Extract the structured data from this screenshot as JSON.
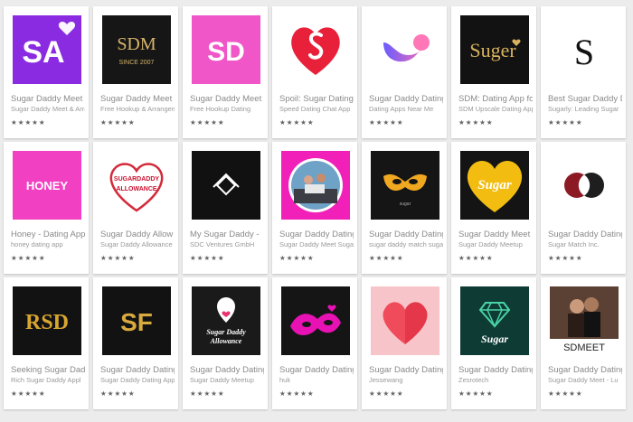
{
  "apps": [
    {
      "title": "Sugar Daddy Meet",
      "developer": "Sugar Daddy Meet & Arrangement",
      "stars": "★★★★★",
      "icon": {
        "name": "sa-logo-icon",
        "bg": "#8a2be2",
        "text": "SA"
      }
    },
    {
      "title": "Sugar Daddy Meet",
      "developer": "Free Hookup & Arrangement",
      "stars": "★★★★★",
      "icon": {
        "name": "sdm-logo-icon",
        "bg": "#161616",
        "text": "SDM",
        "sub": "SINCE 2007"
      }
    },
    {
      "title": "Sugar Daddy Meet",
      "developer": "Free Hookup Dating",
      "stars": "★★★★★",
      "icon": {
        "name": "sd-logo-icon",
        "bg": "#f056c8",
        "text": "SD"
      }
    },
    {
      "title": "Spoil: Sugar Dating",
      "developer": "Speed Dating Chat App",
      "stars": "★★★★★",
      "icon": {
        "name": "heart-s-icon",
        "bg": "#ffffff"
      }
    },
    {
      "title": "Sugar Daddy Dating",
      "developer": "Dating Apps Near Me",
      "stars": "★★★★★",
      "icon": {
        "name": "ribbon-heart-icon",
        "bg": "#ffffff"
      }
    },
    {
      "title": "SDM: Dating App for",
      "developer": "SDM Upscale Dating App",
      "stars": "★★★★★",
      "icon": {
        "name": "suger-logo-icon",
        "bg": "#121212",
        "text": "Suger"
      }
    },
    {
      "title": "Best Sugar Daddy D",
      "developer": "Sugarly: Leading Sugar",
      "stars": "★★★★★",
      "icon": {
        "name": "s-letter-icon",
        "bg": "#ffffff",
        "text": "S"
      }
    },
    {
      "title": "Honey - Dating App",
      "developer": "honey dating app",
      "stars": "★★★★★",
      "icon": {
        "name": "honey-logo-icon",
        "bg": "#f240c2",
        "text": "HONEY"
      }
    },
    {
      "title": "Sugar Daddy Allow",
      "developer": "Sugar Daddy Allowance",
      "stars": "★★★★★",
      "icon": {
        "name": "allowance-heart-icon",
        "bg": "#ffffff",
        "text": "SUGARDADDY",
        "sub": "ALLOWANCE"
      }
    },
    {
      "title": "My Sugar Daddy -",
      "developer": "SDC Ventures GmbH",
      "stars": "★★★★★",
      "icon": {
        "name": "diamond-outline-icon",
        "bg": "#111111"
      }
    },
    {
      "title": "Sugar Daddy Dating",
      "developer": "Sugar Daddy Meet Sugar",
      "stars": "★★★★★",
      "icon": {
        "name": "couple-photo-icon",
        "bg": "#f020b8"
      }
    },
    {
      "title": "Sugar Daddy Dating",
      "developer": "sugar daddy match sugar",
      "stars": "★★★★★",
      "icon": {
        "name": "mask-icon",
        "bg": "#151515",
        "sub": "sugar"
      }
    },
    {
      "title": "Sugar Daddy Meet",
      "developer": "Sugar Daddy Meetup",
      "stars": "★★★★★",
      "icon": {
        "name": "gold-heart-icon",
        "bg": "#141414",
        "text": "Sugar"
      }
    },
    {
      "title": "Sugar Daddy Dating",
      "developer": "Sugar Match Inc.",
      "stars": "★★★★★",
      "icon": {
        "name": "overlap-circles-icon",
        "bg": "#ffffff"
      }
    },
    {
      "title": "Seeking Sugar Dad",
      "developer": "Rich Sugar Daddy Appl",
      "stars": "★★★★★",
      "icon": {
        "name": "rsd-logo-icon",
        "bg": "#121212",
        "text": "RSD"
      }
    },
    {
      "title": "Sugar Daddy Dating",
      "developer": "Sugar Daddy Dating App",
      "stars": "★★★★★",
      "icon": {
        "name": "sf-logo-icon",
        "bg": "#121212",
        "text": "SF"
      }
    },
    {
      "title": "Sugar Daddy Dating",
      "developer": "Sugar Daddy Meetup",
      "stars": "★★★★★",
      "icon": {
        "name": "location-heart-icon",
        "bg": "#1a1a1a",
        "text": "Sugar Daddy",
        "sub": "Allowance"
      }
    },
    {
      "title": "Sugar Daddy Dating",
      "developer": "huk",
      "stars": "★★★★★",
      "icon": {
        "name": "masquerade-icon",
        "bg": "#151515"
      }
    },
    {
      "title": "Sugar Daddy Dating",
      "developer": "Jessewang",
      "stars": "★★★★★",
      "icon": {
        "name": "pink-heart-icon",
        "bg": "#f7c5c9"
      }
    },
    {
      "title": "Sugar Daddy Dating",
      "developer": "Zesrotech",
      "stars": "★★★★★",
      "icon": {
        "name": "diamond-icon",
        "bg": "#0f3b35",
        "text": "Sugar"
      }
    },
    {
      "title": "Sugar Daddy Dating",
      "developer": "Sugar Daddy Meet - Lu",
      "stars": "★★★★★",
      "icon": {
        "name": "sdmeet-photo-icon",
        "bg": "#3a2a24",
        "text": "SDMEET"
      }
    }
  ]
}
